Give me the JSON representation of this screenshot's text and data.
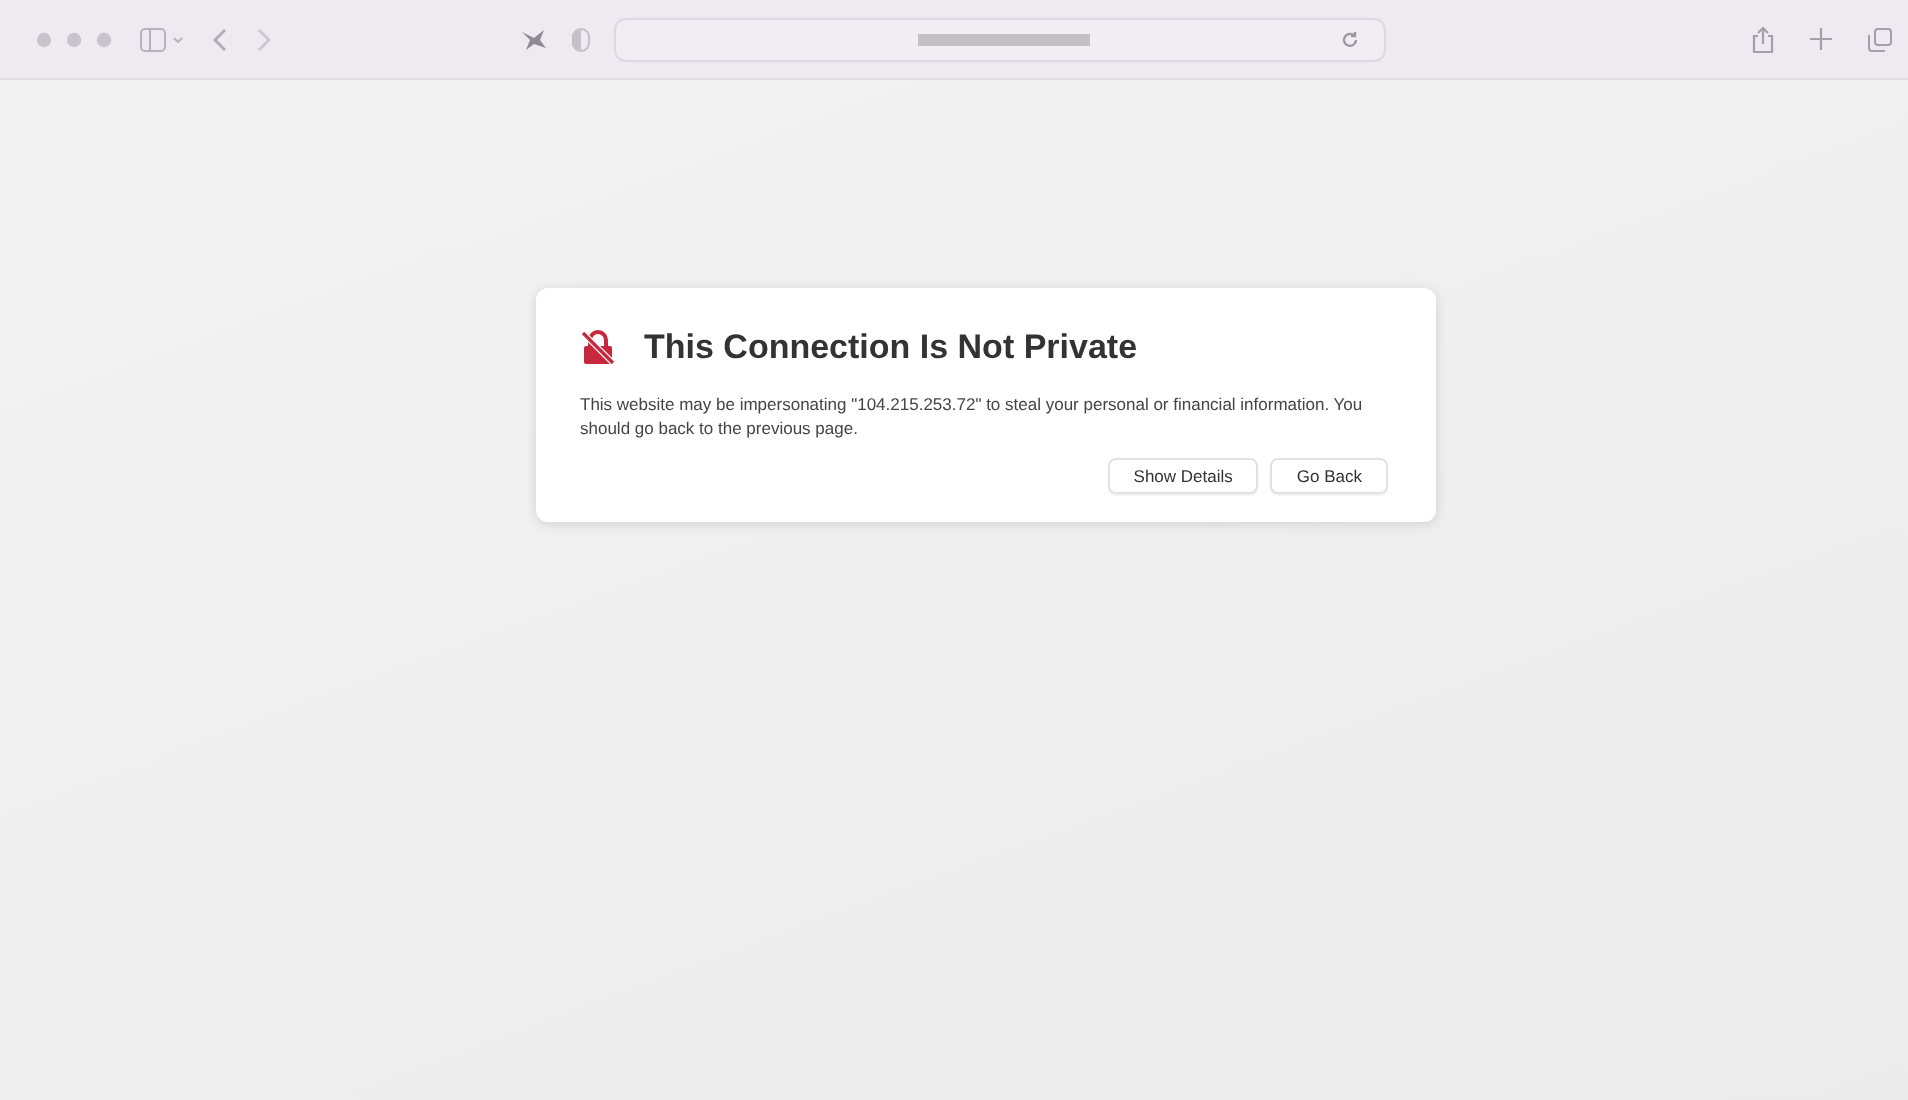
{
  "dialog": {
    "title": "This Connection Is Not Private",
    "message": "This website may be impersonating \"104.215.253.72\" to steal your personal or financial information. You should go back to the previous page.",
    "buttons": [
      "Show Details",
      "Go Back"
    ]
  }
}
